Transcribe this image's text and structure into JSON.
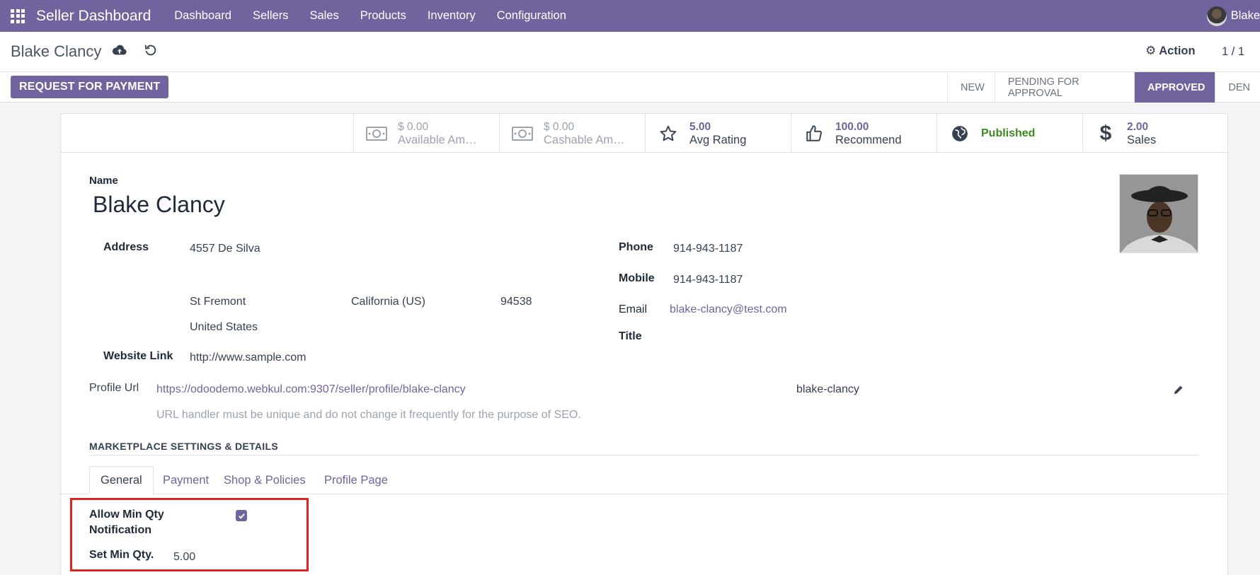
{
  "navbar": {
    "brand": "Seller Dashboard",
    "items": [
      "Dashboard",
      "Sellers",
      "Sales",
      "Products",
      "Inventory",
      "Configuration"
    ],
    "user": "Blake"
  },
  "control": {
    "breadcrumb": "Blake Clancy",
    "action_label": "Action",
    "pager": "1 / 1"
  },
  "statusbar": {
    "request_button": "REQUEST FOR PAYMENT",
    "stages": [
      {
        "label": "NEW",
        "active": false
      },
      {
        "label": "PENDING FOR APPROVAL",
        "active": false
      },
      {
        "label": "APPROVED",
        "active": true
      },
      {
        "label": "DEN",
        "active": false
      }
    ]
  },
  "stats": [
    {
      "value": "$ 0.00",
      "label": "Available Am…",
      "icon": "money-icon"
    },
    {
      "value": "$ 0.00",
      "label": "Cashable Am…",
      "icon": "money-icon"
    },
    {
      "value": "5.00",
      "label": "Avg Rating",
      "icon": "star-icon"
    },
    {
      "value": "100.00",
      "label": "Recommend",
      "icon": "thumbs-up-icon"
    },
    {
      "value": "",
      "label": "Published",
      "icon": "globe-icon"
    },
    {
      "value": "2.00",
      "label": "Sales",
      "icon": "dollar-icon"
    }
  ],
  "form": {
    "name_label": "Name",
    "name": "Blake Clancy",
    "address_label": "Address",
    "street": "4557 De Silva",
    "city": "St Fremont",
    "state": "California (US)",
    "zip": "94538",
    "country": "United States",
    "website_label": "Website Link",
    "website": "http://www.sample.com",
    "phone_label": "Phone",
    "phone": "914-943-1187",
    "mobile_label": "Mobile",
    "mobile": "914-943-1187",
    "email_label": "Email",
    "email": "blake-clancy@test.com",
    "title_label": "Title",
    "profile_url_label": "Profile Url",
    "profile_url": "https://odoodemo.webkul.com:9307/seller/profile/blake-clancy",
    "profile_slug": "blake-clancy",
    "profile_hint": "URL handler must be unique and do not change it frequently for the purpose of SEO."
  },
  "section": {
    "title": "MARKETPLACE SETTINGS & DETAILS",
    "tabs": [
      "General",
      "Payment",
      "Shop & Policies",
      "Profile Page"
    ]
  },
  "general": {
    "allow_min_qty_label_1": "Allow Min Qty",
    "allow_min_qty_label_2": "Notification",
    "allow_min_qty_checked": true,
    "set_min_qty_label": "Set Min Qty.",
    "set_min_qty_value": "5.00"
  },
  "colors": {
    "brand": "#71639e",
    "published": "#3d8a1f",
    "highlight": "#e02424"
  }
}
